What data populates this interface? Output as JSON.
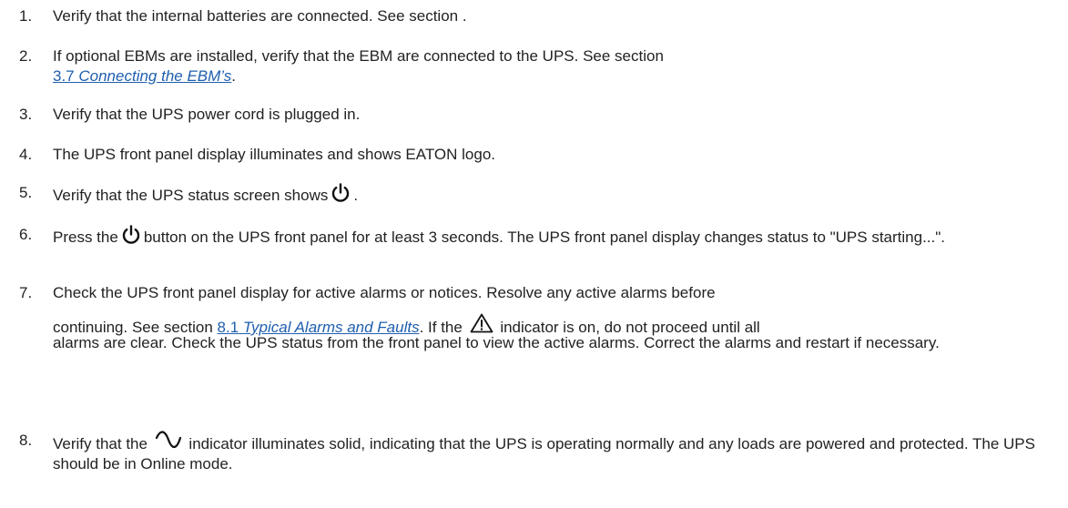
{
  "steps": [
    {
      "number": "1.",
      "text": "Verify that the internal batteries are connected. See section ."
    },
    {
      "number": "2.",
      "text_a": "If optional EBMs are installed, verify that the EBM are connected to the UPS. See section",
      "link_num": "3.7",
      "link_title": "Connecting the EBM’s",
      "text_b": "."
    },
    {
      "number": "3.",
      "text": "Verify that the UPS power cord is plugged in."
    },
    {
      "number": "4.",
      "text": "The UPS front panel display illuminates and shows EATON logo."
    },
    {
      "number": "5.",
      "text_a": "Verify that the UPS status screen shows",
      "text_b": "."
    },
    {
      "number": "6.",
      "text_a": "Press the",
      "text_b": "button on the UPS front panel for at least 3 seconds. The UPS front panel display changes status to \"UPS starting...\"."
    },
    {
      "number": "7.",
      "text_a": "Check the UPS front panel display for active alarms or notices. Resolve any active alarms before",
      "text_b": "continuing. See section",
      "link_num": "8.1",
      "link_title": "Typical Alarms and Faults",
      "text_c": ". If the",
      "text_d": "indicator is on, do not proceed until all",
      "text_e": "alarms are clear. Check the UPS status from the front panel to view the active alarms. Correct the alarms and restart if necessary."
    },
    {
      "number": "8.",
      "text_a": "Verify that the",
      "text_b": "indicator illuminates solid, indicating that the UPS is operating normally and any loads are powered and protected. The UPS should be in Online mode."
    }
  ],
  "icons": {
    "power": "power-icon",
    "warning": "warning-triangle-icon",
    "sine": "sine-wave-icon"
  },
  "colors": {
    "text": "#222222",
    "link": "#1f5fae"
  }
}
